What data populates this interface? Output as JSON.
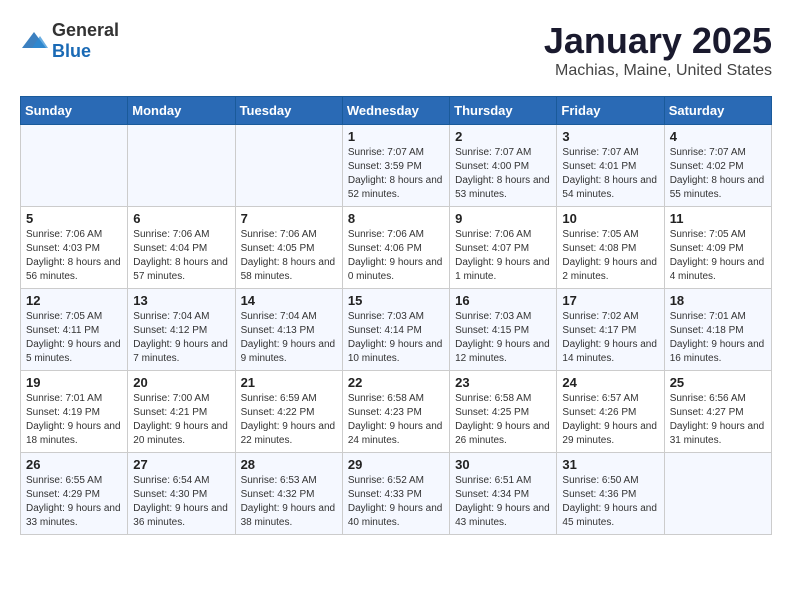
{
  "logo": {
    "general": "General",
    "blue": "Blue"
  },
  "header": {
    "month": "January 2025",
    "location": "Machias, Maine, United States"
  },
  "weekdays": [
    "Sunday",
    "Monday",
    "Tuesday",
    "Wednesday",
    "Thursday",
    "Friday",
    "Saturday"
  ],
  "weeks": [
    [
      {
        "day": "",
        "content": ""
      },
      {
        "day": "",
        "content": ""
      },
      {
        "day": "",
        "content": ""
      },
      {
        "day": "1",
        "content": "Sunrise: 7:07 AM\nSunset: 3:59 PM\nDaylight: 8 hours\nand 52 minutes."
      },
      {
        "day": "2",
        "content": "Sunrise: 7:07 AM\nSunset: 4:00 PM\nDaylight: 8 hours\nand 53 minutes."
      },
      {
        "day": "3",
        "content": "Sunrise: 7:07 AM\nSunset: 4:01 PM\nDaylight: 8 hours\nand 54 minutes."
      },
      {
        "day": "4",
        "content": "Sunrise: 7:07 AM\nSunset: 4:02 PM\nDaylight: 8 hours\nand 55 minutes."
      }
    ],
    [
      {
        "day": "5",
        "content": "Sunrise: 7:06 AM\nSunset: 4:03 PM\nDaylight: 8 hours\nand 56 minutes."
      },
      {
        "day": "6",
        "content": "Sunrise: 7:06 AM\nSunset: 4:04 PM\nDaylight: 8 hours\nand 57 minutes."
      },
      {
        "day": "7",
        "content": "Sunrise: 7:06 AM\nSunset: 4:05 PM\nDaylight: 8 hours\nand 58 minutes."
      },
      {
        "day": "8",
        "content": "Sunrise: 7:06 AM\nSunset: 4:06 PM\nDaylight: 9 hours\nand 0 minutes."
      },
      {
        "day": "9",
        "content": "Sunrise: 7:06 AM\nSunset: 4:07 PM\nDaylight: 9 hours\nand 1 minute."
      },
      {
        "day": "10",
        "content": "Sunrise: 7:05 AM\nSunset: 4:08 PM\nDaylight: 9 hours\nand 2 minutes."
      },
      {
        "day": "11",
        "content": "Sunrise: 7:05 AM\nSunset: 4:09 PM\nDaylight: 9 hours\nand 4 minutes."
      }
    ],
    [
      {
        "day": "12",
        "content": "Sunrise: 7:05 AM\nSunset: 4:11 PM\nDaylight: 9 hours\nand 5 minutes."
      },
      {
        "day": "13",
        "content": "Sunrise: 7:04 AM\nSunset: 4:12 PM\nDaylight: 9 hours\nand 7 minutes."
      },
      {
        "day": "14",
        "content": "Sunrise: 7:04 AM\nSunset: 4:13 PM\nDaylight: 9 hours\nand 9 minutes."
      },
      {
        "day": "15",
        "content": "Sunrise: 7:03 AM\nSunset: 4:14 PM\nDaylight: 9 hours\nand 10 minutes."
      },
      {
        "day": "16",
        "content": "Sunrise: 7:03 AM\nSunset: 4:15 PM\nDaylight: 9 hours\nand 12 minutes."
      },
      {
        "day": "17",
        "content": "Sunrise: 7:02 AM\nSunset: 4:17 PM\nDaylight: 9 hours\nand 14 minutes."
      },
      {
        "day": "18",
        "content": "Sunrise: 7:01 AM\nSunset: 4:18 PM\nDaylight: 9 hours\nand 16 minutes."
      }
    ],
    [
      {
        "day": "19",
        "content": "Sunrise: 7:01 AM\nSunset: 4:19 PM\nDaylight: 9 hours\nand 18 minutes."
      },
      {
        "day": "20",
        "content": "Sunrise: 7:00 AM\nSunset: 4:21 PM\nDaylight: 9 hours\nand 20 minutes."
      },
      {
        "day": "21",
        "content": "Sunrise: 6:59 AM\nSunset: 4:22 PM\nDaylight: 9 hours\nand 22 minutes."
      },
      {
        "day": "22",
        "content": "Sunrise: 6:58 AM\nSunset: 4:23 PM\nDaylight: 9 hours\nand 24 minutes."
      },
      {
        "day": "23",
        "content": "Sunrise: 6:58 AM\nSunset: 4:25 PM\nDaylight: 9 hours\nand 26 minutes."
      },
      {
        "day": "24",
        "content": "Sunrise: 6:57 AM\nSunset: 4:26 PM\nDaylight: 9 hours\nand 29 minutes."
      },
      {
        "day": "25",
        "content": "Sunrise: 6:56 AM\nSunset: 4:27 PM\nDaylight: 9 hours\nand 31 minutes."
      }
    ],
    [
      {
        "day": "26",
        "content": "Sunrise: 6:55 AM\nSunset: 4:29 PM\nDaylight: 9 hours\nand 33 minutes."
      },
      {
        "day": "27",
        "content": "Sunrise: 6:54 AM\nSunset: 4:30 PM\nDaylight: 9 hours\nand 36 minutes."
      },
      {
        "day": "28",
        "content": "Sunrise: 6:53 AM\nSunset: 4:32 PM\nDaylight: 9 hours\nand 38 minutes."
      },
      {
        "day": "29",
        "content": "Sunrise: 6:52 AM\nSunset: 4:33 PM\nDaylight: 9 hours\nand 40 minutes."
      },
      {
        "day": "30",
        "content": "Sunrise: 6:51 AM\nSunset: 4:34 PM\nDaylight: 9 hours\nand 43 minutes."
      },
      {
        "day": "31",
        "content": "Sunrise: 6:50 AM\nSunset: 4:36 PM\nDaylight: 9 hours\nand 45 minutes."
      },
      {
        "day": "",
        "content": ""
      }
    ]
  ]
}
